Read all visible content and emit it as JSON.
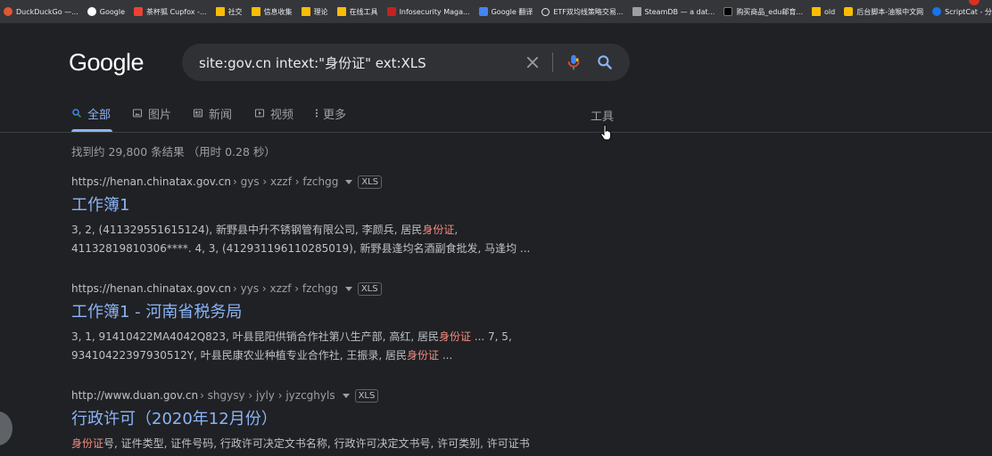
{
  "bookmarks": [
    {
      "label": "DuckDuckGo —...",
      "icon": "duckduckgo-icon"
    },
    {
      "label": "Google",
      "icon": "google-icon"
    },
    {
      "label": "茶杯狐 Cupfox -...",
      "icon": "cupfox-icon"
    },
    {
      "label": "社交",
      "icon": "folder-icon"
    },
    {
      "label": "信息收集",
      "icon": "folder-icon"
    },
    {
      "label": "理论",
      "icon": "folder-icon"
    },
    {
      "label": "在线工具",
      "icon": "folder-icon"
    },
    {
      "label": "Infosecurity Maga...",
      "icon": "infosecurity-icon"
    },
    {
      "label": "Google 翻译",
      "icon": "google-translate-icon"
    },
    {
      "label": "ETF双均线策略交易...",
      "icon": "etf-icon"
    },
    {
      "label": "SteamDB — a dat...",
      "icon": "steamdb-icon"
    },
    {
      "label": "购买商品_edu邮育...",
      "icon": "shop-icon"
    },
    {
      "label": "old",
      "icon": "folder-icon"
    },
    {
      "label": "后台脚本-油猴中文网",
      "icon": "greasyfork-icon"
    },
    {
      "label": "ScriptCat - 分享你...",
      "icon": "scriptcat-icon"
    }
  ],
  "header": {
    "logo": "Google",
    "search_query": "site:gov.cn intext:\"身份证\" ext:XLS"
  },
  "tabs": [
    {
      "label": "全部",
      "icon": "search-icon",
      "active": true
    },
    {
      "label": "图片",
      "icon": "image-icon",
      "active": false
    },
    {
      "label": "新闻",
      "icon": "news-icon",
      "active": false
    },
    {
      "label": "视频",
      "icon": "video-icon",
      "active": false
    },
    {
      "label": "更多",
      "icon": "more-vert-icon",
      "active": false
    }
  ],
  "tools_label": "工具",
  "stats": "找到约 29,800 条结果  （用时 0.28 秒）",
  "results": [
    {
      "domain": "https://henan.chinatax.gov.cn",
      "crumbs": "› gys › xzzf › fzchgg",
      "filetype": "XLS",
      "title": "工作簿1",
      "snippet_line1_a": "3, 2, (411329551615124), 新野县中升不锈钢管有限公司, 李颜兵, 居民",
      "snippet_line1_hl": "身份证",
      "snippet_line1_b": ",",
      "snippet_line2": "41132819810306****. 4, 3, (412931196110285019), 新野县逢均名酒副食批发, 马逢均 ..."
    },
    {
      "domain": "https://henan.chinatax.gov.cn",
      "crumbs": "› yys › xzzf › fzchgg",
      "filetype": "XLS",
      "title": "工作簿1 - 河南省税务局",
      "snippet_line1_a": "3, 1, 91410422MA4042Q823, 叶县昆阳供销合作社第八生产部, 高红, 居民",
      "snippet_line1_hl": "身份证",
      "snippet_line1_b": " ... 7, 5,",
      "snippet_line2_a": "93410422397930512Y, 叶县民康农业种植专业合作社, 王振录, 居民",
      "snippet_line2_hl": "身份证",
      "snippet_line2_b": " ..."
    },
    {
      "domain": "http://www.duan.gov.cn",
      "crumbs": "› shgysy › jyly › jyzcghyls",
      "filetype": "XLS",
      "title": "行政许可（2020年12月份）",
      "snippet_line1_hl": "身份证",
      "snippet_line1_b": "号, 证件类型, 证件号码, 行政许可决定文书名称, 行政许可决定文书号, 许可类别, 许可证书"
    }
  ],
  "colors": {
    "background": "#202124",
    "link": "#8ab4f8",
    "highlight": "#f28b82",
    "searchbox": "#303134"
  }
}
